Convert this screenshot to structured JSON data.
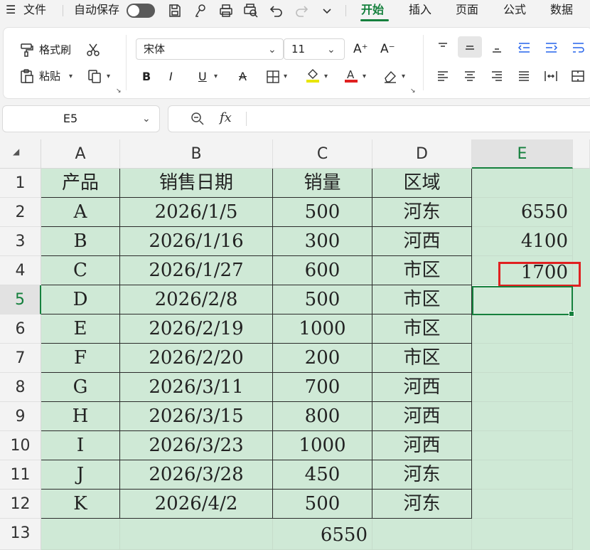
{
  "menubar": {
    "hamburger_icon": "☰",
    "file_label": "文件",
    "autosave_label": "自动保存",
    "tabs": [
      "开始",
      "插入",
      "页面",
      "公式",
      "数据"
    ]
  },
  "ribbon": {
    "format_painter": "格式刷",
    "paste": "粘贴",
    "font_name": "宋体",
    "font_size": "11"
  },
  "formula_bar": {
    "cell_ref": "E5",
    "fx": "fx",
    "formula": ""
  },
  "sheet": {
    "columns": [
      "A",
      "B",
      "C",
      "D",
      "E"
    ],
    "row_numbers": [
      "1",
      "2",
      "3",
      "4",
      "5",
      "6",
      "7",
      "8",
      "9",
      "10",
      "11",
      "12",
      "13"
    ],
    "headers": [
      "产品",
      "销售日期",
      "销量",
      "区域"
    ],
    "rows": [
      [
        "A",
        "2026/1/5",
        "500",
        "河东"
      ],
      [
        "B",
        "2026/1/16",
        "300",
        "河西"
      ],
      [
        "C",
        "2026/1/27",
        "600",
        "市区"
      ],
      [
        "D",
        "2026/2/8",
        "500",
        "市区"
      ],
      [
        "E",
        "2026/2/19",
        "1000",
        "市区"
      ],
      [
        "F",
        "2026/2/20",
        "200",
        "市区"
      ],
      [
        "G",
        "2026/3/11",
        "700",
        "河西"
      ],
      [
        "H",
        "2026/3/15",
        "800",
        "河西"
      ],
      [
        "I",
        "2026/3/23",
        "1000",
        "河西"
      ],
      [
        "J",
        "2026/3/28",
        "450",
        "河东"
      ],
      [
        "K",
        "2026/4/2",
        "500",
        "河东"
      ]
    ],
    "e_column": [
      "",
      "6550",
      "4100",
      "1700"
    ],
    "total": "6550",
    "selected_cell": "E5",
    "highlight_cell": "E4",
    "fill_color": "#cfe9d6",
    "accent_color": "#15803d",
    "highlight_color": "#e02020"
  }
}
